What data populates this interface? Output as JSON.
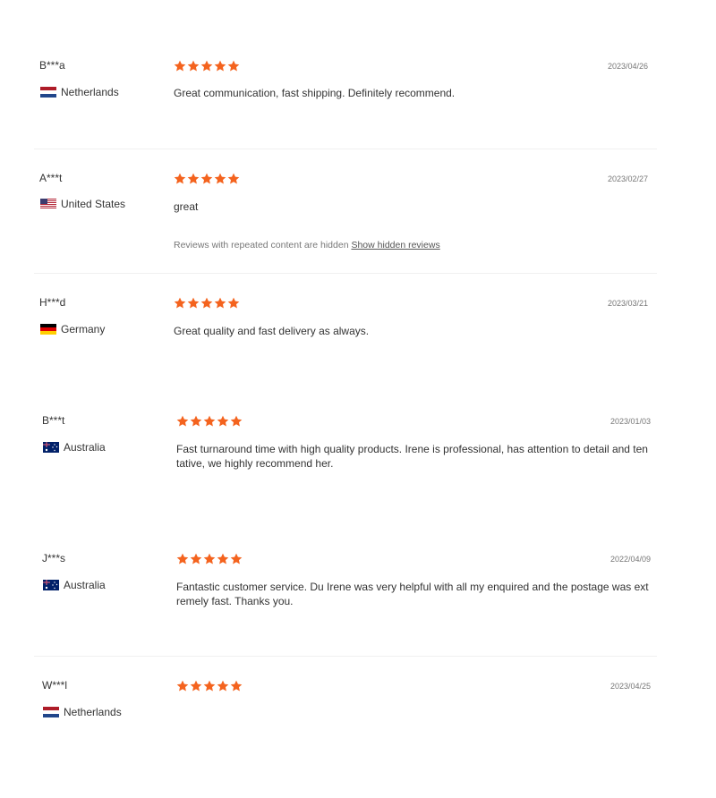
{
  "colors": {
    "star": "#f4631e",
    "divider": "#f0f0f0",
    "date": "#777777"
  },
  "reviews": [
    {
      "name": "B***a",
      "country": "Netherlands",
      "flag": "netherlands-flag",
      "rating": 5,
      "date": "2023/04/26",
      "text": "Great communication, fast shipping. Definitely recommend."
    },
    {
      "name": "A***t",
      "country": "United States",
      "flag": "united-states-flag",
      "rating": 5,
      "date": "2023/02/27",
      "text": "great",
      "hidden_note": "Reviews with repeated content are hidden",
      "hidden_link": "Show hidden reviews"
    },
    {
      "name": "H***d",
      "country": "Germany",
      "flag": "germany-flag",
      "rating": 5,
      "date": "2023/03/21",
      "text": "Great quality and fast delivery as always."
    },
    {
      "name": "B***t",
      "country": "Australia",
      "flag": "australia-flag",
      "rating": 5,
      "date": "2023/01/03",
      "text": "Fast turnaround time with high quality products. Irene is professional, has attention to detail and ten tative, we highly recommend her."
    },
    {
      "name": "J***s",
      "country": "Australia",
      "flag": "australia-flag",
      "rating": 5,
      "date": "2022/04/09",
      "text": "Fantastic customer service. Du Irene was very helpful with all my enquired and the postage was ext remely fast. Thanks you."
    },
    {
      "name": "W***l",
      "country": "Netherlands",
      "flag": "netherlands-flag",
      "rating": 5,
      "date": "2023/04/25",
      "text": ""
    }
  ]
}
